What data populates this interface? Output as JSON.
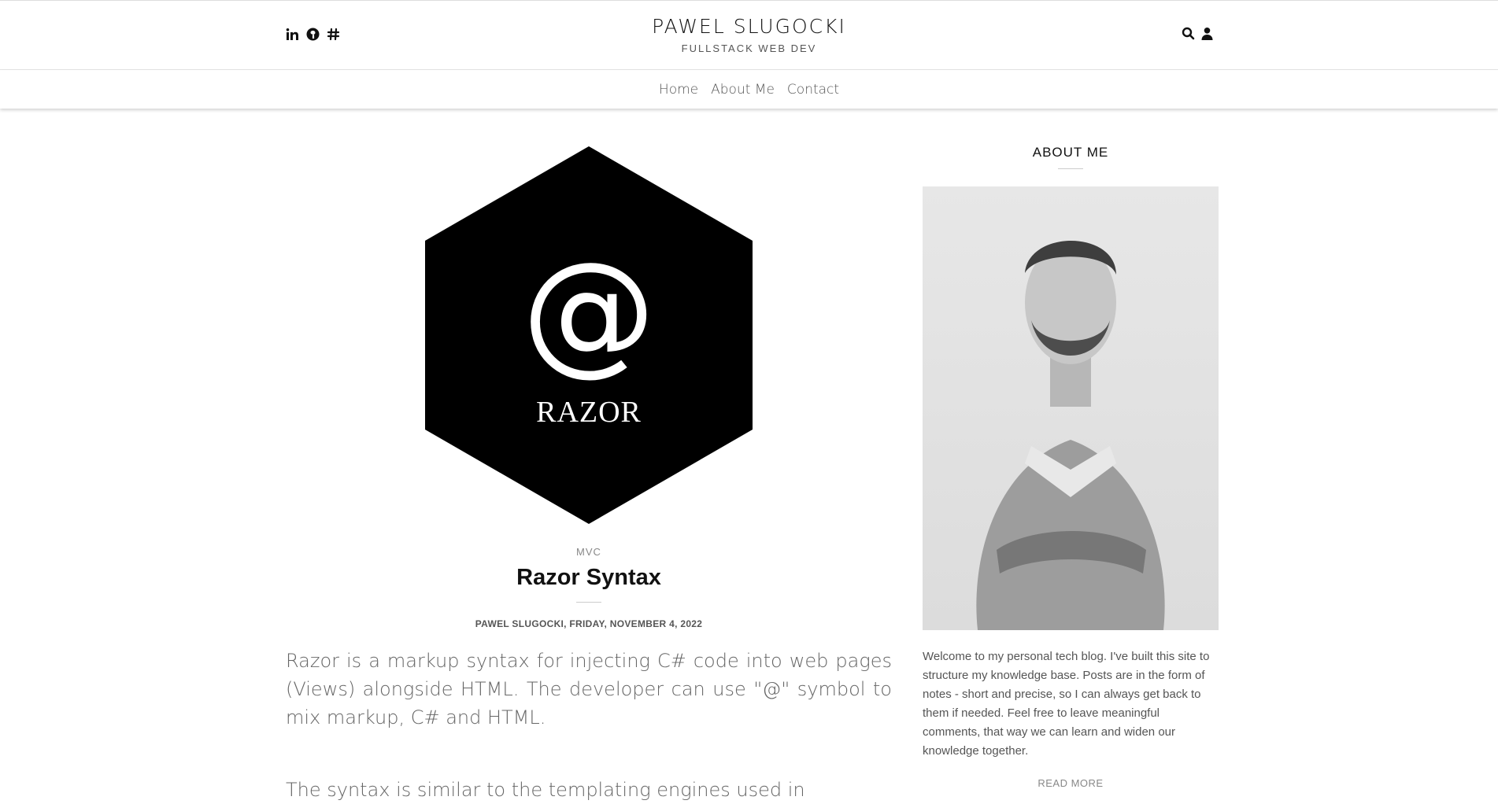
{
  "header": {
    "site_title": "PAWEL SLUGOCKI",
    "site_subtitle": "FULLSTACK WEB DEV",
    "social_icons": [
      "linkedin-icon",
      "github-icon",
      "hashnode-icon"
    ],
    "tool_icons": [
      "search-icon",
      "user-icon"
    ]
  },
  "nav": {
    "items": [
      {
        "label": "Home"
      },
      {
        "label": "About Me"
      },
      {
        "label": "Contact"
      }
    ]
  },
  "post": {
    "hero_symbol": "@",
    "hero_label": "RAZOR",
    "category": "MVC",
    "title": "Razor Syntax",
    "byline": "PAWEL SLUGOCKI, FRIDAY, NOVEMBER 4, 2022",
    "paragraphs": [
      "Razor is a markup syntax for injecting C# code into web pages (Views) alongside HTML. The developer can use \"@\" symbol to mix markup, C# and HTML.",
      "The syntax is similar to the templating engines used in"
    ]
  },
  "sidebar": {
    "heading": "ABOUT ME",
    "about_text": "Welcome to my personal tech blog. I've built this site to structure my knowledge base. Posts are in the form of notes - short and precise, so I can always get back to them if needed. Feel free to leave meaningful comments, that way we can learn and widen our knowledge together.",
    "read_more": "READ MORE"
  }
}
